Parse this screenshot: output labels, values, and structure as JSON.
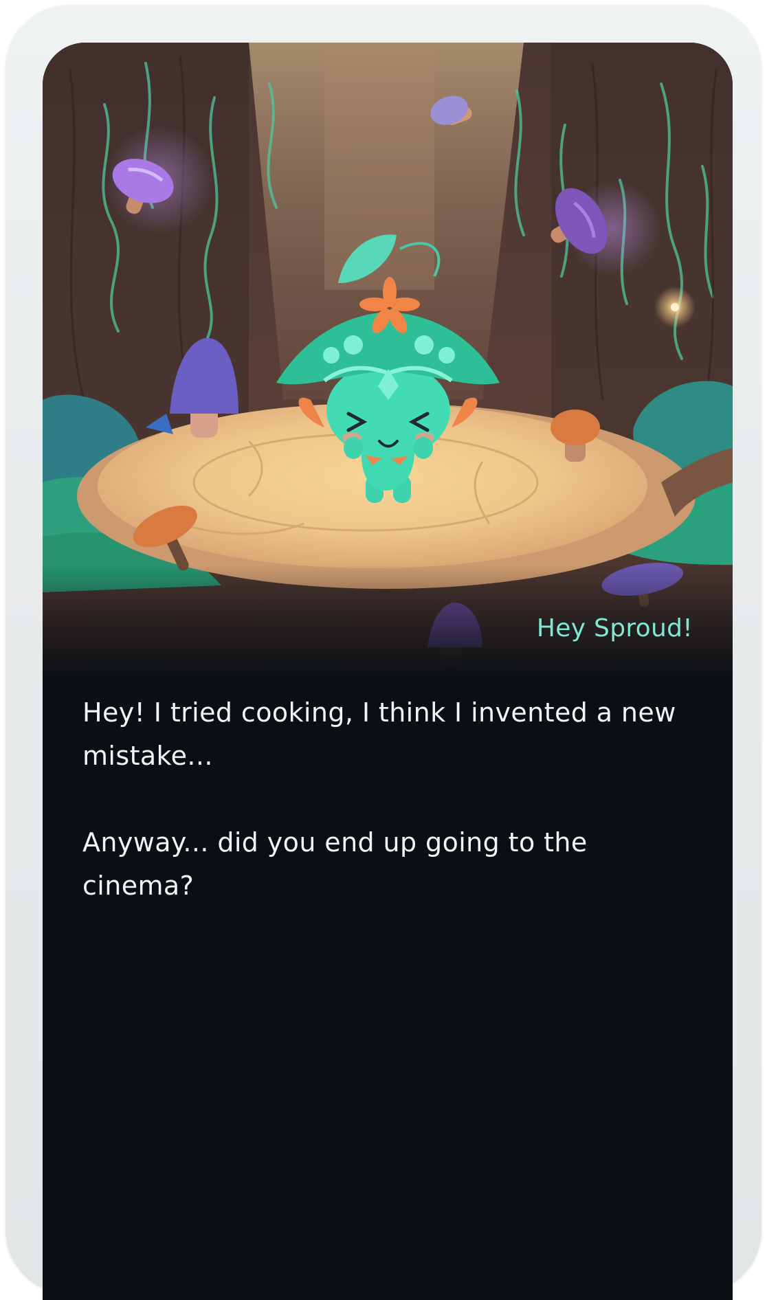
{
  "dialog": {
    "speaker_label": "Hey Sproud!",
    "paragraphs": [
      "Hey! I tried cooking, I think I invented a new mistake...",
      "Anyway... did you end up going to the cinema?"
    ]
  },
  "scene": {
    "character_name": "Sproud",
    "description_icon": "forest-clearing-illustration"
  },
  "colors": {
    "accent": "#7fe8d2",
    "text": "#f2f4f5",
    "background": "#0a0f13",
    "frame": "#e9eced"
  }
}
